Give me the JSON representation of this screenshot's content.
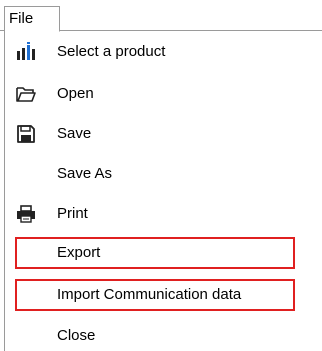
{
  "menubar": {
    "file_label": "File"
  },
  "menu": {
    "items": [
      {
        "label": "Select a product",
        "icon": "product-bars-icon"
      },
      {
        "label": "Open",
        "icon": "folder-open-icon"
      },
      {
        "label": "Save",
        "icon": "floppy-disk-icon"
      },
      {
        "label": "Save As",
        "icon": ""
      },
      {
        "label": "Print",
        "icon": "printer-icon"
      },
      {
        "label": "Export",
        "icon": "",
        "highlight_color": "#e02020"
      },
      {
        "label": "Import Communication data",
        "icon": "",
        "highlight_color": "#e02020"
      },
      {
        "label": "Close",
        "icon": ""
      }
    ]
  },
  "colors": {
    "border": "#9a9a9a",
    "highlight": "#e02020",
    "icon_blue": "#1f6fd1",
    "icon_dark": "#222222"
  }
}
